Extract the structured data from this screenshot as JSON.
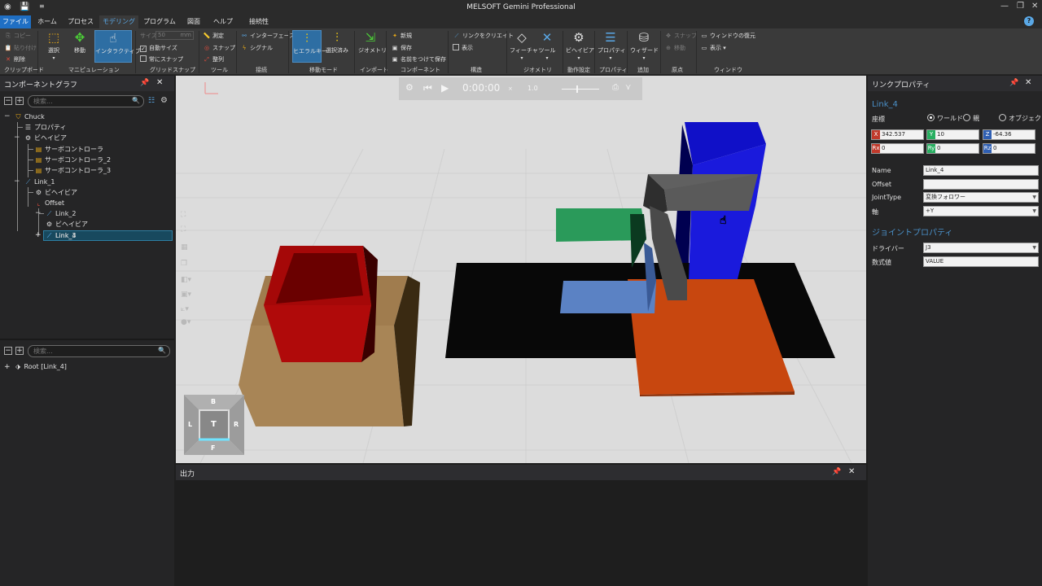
{
  "window": {
    "title": "MELSOFT Gemini Professional"
  },
  "menu": {
    "tabs": [
      "ファイル",
      "ホーム",
      "プロセス",
      "モデリング",
      "プログラム",
      "図面",
      "ヘルプ",
      "接続性"
    ],
    "help": "?"
  },
  "ribbon": {
    "clipboard": {
      "group": "クリップボード",
      "copy": "コピー",
      "paste": "貼り付け",
      "delete": "削除"
    },
    "manipulation": {
      "group": "マニピュレーション",
      "select": "選択",
      "move": "移動",
      "interactive": "インタラクティブ"
    },
    "grid_snap": {
      "group": "グリッドスナップ",
      "size_label": "サイズ",
      "size_value": "50",
      "unit": "mm",
      "auto_size": "自動サイズ",
      "always_snap": "常にスナップ"
    },
    "tools": {
      "group": "ツール",
      "measure": "測定",
      "snap": "スナップ",
      "align": "整列"
    },
    "connection": {
      "group": "接続",
      "interface": "インターフェース",
      "signal": "シグナル"
    },
    "move_mode": {
      "group": "移動モード",
      "hierarchy": "ヒエラルキー",
      "selected": "選択済み"
    },
    "import": {
      "group": "インポート",
      "geometry": "ジオメトリ"
    },
    "component": {
      "group": "コンポーネント",
      "new": "新規",
      "save": "保存",
      "save_as": "名前をつけて保存"
    },
    "structure": {
      "group": "構造",
      "create_link": "リンクをクリエイト",
      "show": "表示"
    },
    "geometry": {
      "group": "ジオメトリ",
      "feature": "フィーチャ",
      "tool": "ツール"
    },
    "behavior_settings": {
      "group": "動作設定",
      "behavior": "ビヘイビア"
    },
    "property": {
      "group": "プロパティ",
      "property": "プロパティ"
    },
    "add": {
      "group": "追加",
      "wizard": "ウィザード"
    },
    "origin": {
      "group": "原点",
      "snap": "スナップ",
      "move": "移動"
    },
    "window": {
      "group": "ウィンドウ",
      "restore": "ウィンドウの復元",
      "show": "表示"
    }
  },
  "component_graph": {
    "title": "コンポーネントグラフ",
    "search_placeholder": "検索...",
    "tree": [
      {
        "label": "Chuck",
        "icon": "component-icon"
      },
      {
        "label": "プロパティ",
        "icon": "properties-icon"
      },
      {
        "label": "ビヘイビア",
        "icon": "gear-icon"
      },
      {
        "label": "サーボコントローラ",
        "icon": "controller-icon"
      },
      {
        "label": "サーボコントローラ_2",
        "icon": "controller-icon"
      },
      {
        "label": "サーボコントローラ_3",
        "icon": "controller-icon"
      },
      {
        "label": "Link_1",
        "icon": "link-icon"
      },
      {
        "label": "ビヘイビア",
        "icon": "gear-icon"
      },
      {
        "label": "Offset",
        "icon": "frame-icon"
      },
      {
        "label": "Link_2",
        "icon": "link-icon"
      },
      {
        "label": "ビヘイビア",
        "icon": "gear-icon"
      },
      {
        "label": "Link_3",
        "icon": "link-icon"
      },
      {
        "label": "Link_4",
        "icon": "link-icon"
      }
    ],
    "bottom_search_placeholder": "検索...",
    "root_item": "Root [Link_4]"
  },
  "playback": {
    "time": "0:00:00",
    "speed": "1.0"
  },
  "navcube": {
    "top": "B",
    "left": "L",
    "center": "T",
    "right": "R",
    "bottom": "F"
  },
  "output": {
    "title": "出力"
  },
  "link_properties": {
    "title": "リンクプロパティ",
    "link_name": "Link_4",
    "coord_label": "座標",
    "coord_options": [
      "ワールド",
      "親",
      "オブジェクト"
    ],
    "coord_selected": "ワールド",
    "x": "342.537",
    "y": "10",
    "z": "-64.36",
    "rx": "0",
    "ry": "0",
    "rz": "0",
    "axis_labels": {
      "x": "X",
      "y": "Y",
      "z": "Z",
      "rx": "Rx",
      "ry": "Ry",
      "rz": "Rz"
    },
    "fields": [
      {
        "label": "Name",
        "value": "Link_4"
      },
      {
        "label": "Offset",
        "value": ""
      },
      {
        "label": "JointType",
        "value": "変換フォロワー"
      },
      {
        "label": "軸",
        "value": "+Y"
      }
    ],
    "joint_section": "ジョイントプロパティ",
    "joint_fields": [
      {
        "label": "ドライバー",
        "value": "J3"
      },
      {
        "label": "数式値",
        "value": "VALUE"
      }
    ]
  },
  "colors": {
    "accent": "#1f6fc4",
    "active_tab": "#5aa8e6",
    "selection": "#18495e",
    "axis_x": "#c0392b",
    "axis_y": "#27ae60",
    "axis_z": "#2f5fb3"
  }
}
